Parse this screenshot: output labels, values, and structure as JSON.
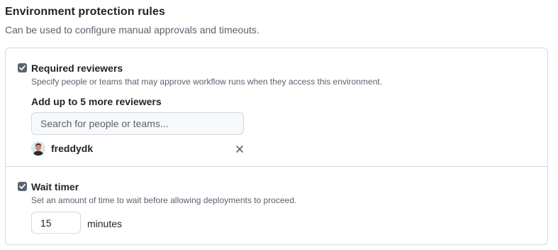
{
  "section": {
    "title": "Environment protection rules",
    "description": "Can be used to configure manual approvals and timeouts."
  },
  "required_reviewers": {
    "checked": true,
    "label": "Required reviewers",
    "description": "Specify people or teams that may approve workflow runs when they access this environment.",
    "add_label": "Add up to 5 more reviewers",
    "search_placeholder": "Search for people or teams...",
    "reviewers": [
      {
        "name": "freddydk",
        "avatar_icon": "user-avatar",
        "remove_icon": "close-icon"
      }
    ]
  },
  "wait_timer": {
    "checked": true,
    "label": "Wait timer",
    "description": "Set an amount of time to wait before allowing deployments to proceed.",
    "value": "15",
    "unit": "minutes"
  },
  "colors": {
    "text": "#1f2328",
    "muted": "#59636e",
    "border": "#d1d9e0",
    "input_bg": "#f6f8fa",
    "checkbox": "#59636e"
  }
}
